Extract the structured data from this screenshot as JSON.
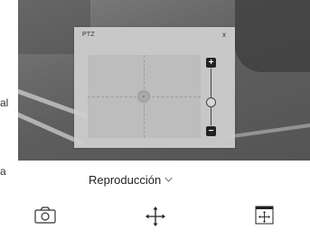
{
  "side_fragments": {
    "top": "al",
    "bottom": "a"
  },
  "ptz_panel": {
    "title": "PTZ",
    "close_label": "x",
    "zoom_in_label": "+",
    "zoom_out_label": "−",
    "zoom_level_fraction": 0.4
  },
  "controls": {
    "playback_label": "Reproducción",
    "playback_icon": "chevron-down-icon",
    "snapshot_icon": "camera-icon",
    "move_icon": "move-arrows-icon",
    "ptz_toggle_icon": "ptz-window-icon"
  },
  "colors": {
    "panel_bg": "#cecece",
    "joystick_bg": "#bdbdbd",
    "icon_dark": "#222222"
  }
}
